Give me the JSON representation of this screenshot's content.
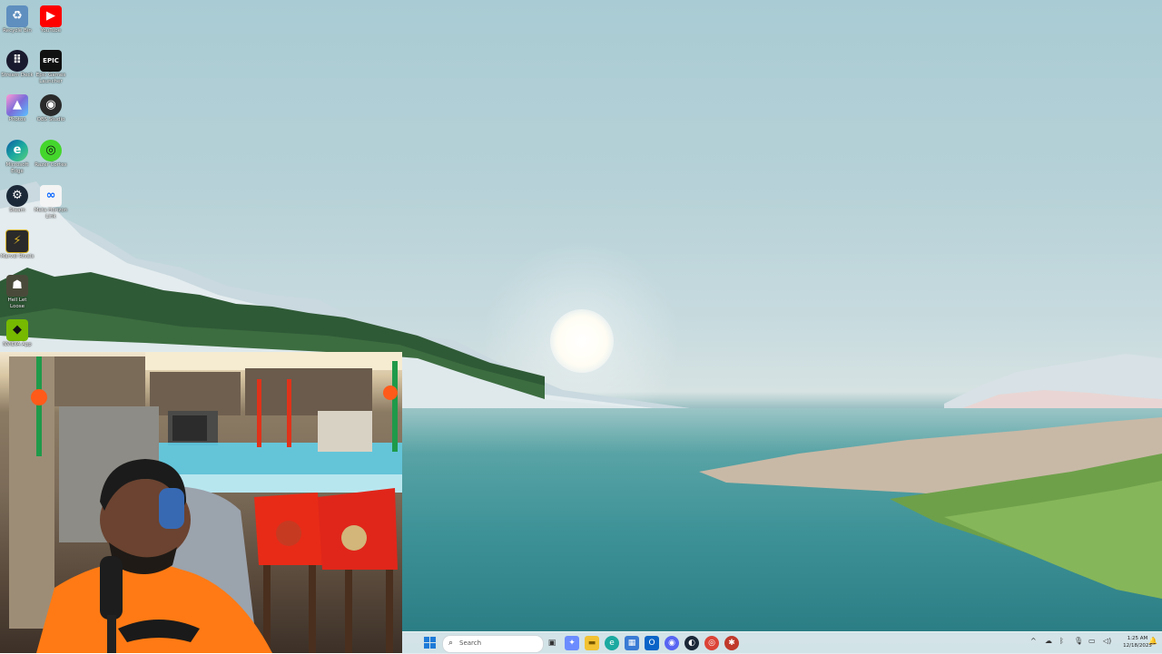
{
  "desktop": {
    "icons": [
      {
        "label": "Recycle Bin",
        "icon": "recycle-bin-icon",
        "color": "#5f8fbf"
      },
      {
        "label": "YouTube",
        "icon": "youtube-icon",
        "color": "#ff0000"
      },
      {
        "label": "Stream Deck",
        "icon": "stream-deck-icon",
        "color": "#1a1a2e"
      },
      {
        "label": "Epic Games Launcher",
        "icon": "epic-games-icon",
        "color": "#111111"
      },
      {
        "label": "Photos",
        "icon": "photos-icon",
        "color": "#7b6cd9"
      },
      {
        "label": "OBS Studio",
        "icon": "obs-icon",
        "color": "#2a2a2a"
      },
      {
        "label": "Microsoft Edge",
        "icon": "edge-icon",
        "color": "#1ba9a0"
      },
      {
        "label": "Razer Cortex",
        "icon": "razer-cortex-icon",
        "color": "#44d62c"
      },
      {
        "label": "Steam",
        "icon": "steam-icon",
        "color": "#1b2838"
      },
      {
        "label": "Meta Horizon Link",
        "icon": "meta-icon",
        "color": "#f4f4f4"
      },
      {
        "label": "Marvel Rivals",
        "icon": "marvel-rivals-icon",
        "color": "#d8b227"
      },
      {
        "label": "Hell Let Loose",
        "icon": "hell-let-loose-icon",
        "color": "#4a4a3a"
      },
      {
        "label": "NVIDIA App",
        "icon": "nvidia-icon",
        "color": "#76b900"
      }
    ]
  },
  "taskbar": {
    "search_placeholder": "Search",
    "apps": [
      {
        "name": "task-view",
        "icon": "task-view-icon",
        "color": "#333333",
        "glyph": "▣"
      },
      {
        "name": "copilot",
        "icon": "copilot-icon",
        "color": "#6b8cff",
        "glyph": "✦"
      },
      {
        "name": "file-explorer",
        "icon": "folder-icon",
        "color": "#f2c233",
        "glyph": "▬"
      },
      {
        "name": "edge",
        "icon": "edge-icon",
        "color": "#1ba9a0",
        "glyph": "e"
      },
      {
        "name": "store",
        "icon": "store-icon",
        "color": "#3a7bd5",
        "glyph": "▦"
      },
      {
        "name": "outlook",
        "icon": "outlook-icon",
        "color": "#0a64c8",
        "glyph": "O"
      },
      {
        "name": "discord",
        "icon": "discord-icon",
        "color": "#5865f2",
        "glyph": "◉"
      },
      {
        "name": "steam",
        "icon": "steam-icon",
        "color": "#1b2838",
        "glyph": "◐"
      },
      {
        "name": "chrome",
        "icon": "chrome-icon",
        "color": "#db4437",
        "glyph": "◎"
      },
      {
        "name": "app-extra",
        "icon": "app-icon",
        "color": "#c0392b",
        "glyph": "✱"
      }
    ],
    "tray": {
      "chevron": "^",
      "time": "1:25 AM",
      "date": "12/18/2025"
    }
  }
}
